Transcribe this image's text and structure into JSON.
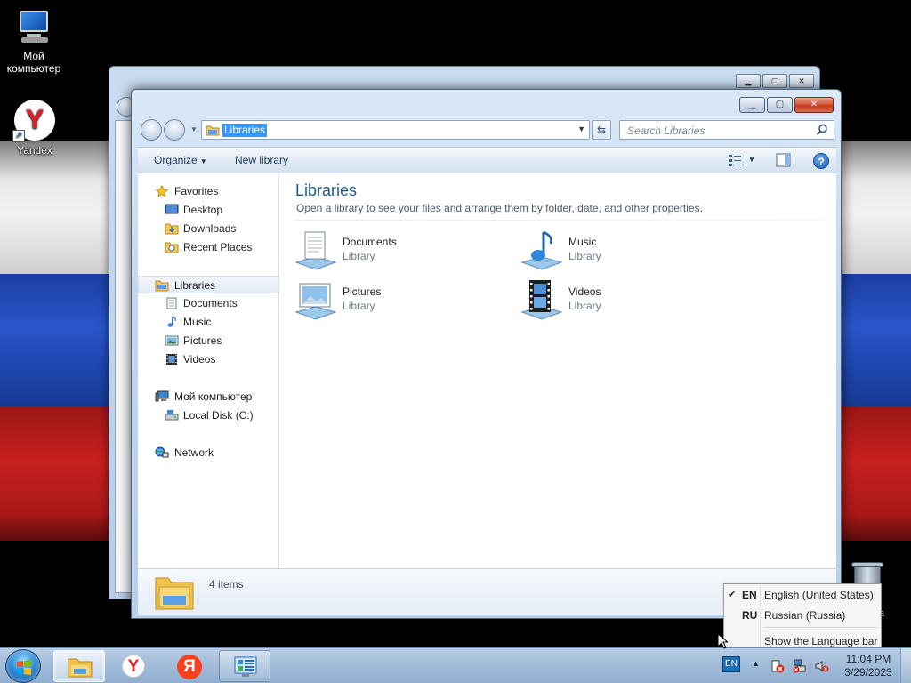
{
  "desktop": {
    "icons": [
      {
        "label": "Мой компьютер",
        "icon": "computer-icon"
      },
      {
        "label": "Yandex",
        "icon": "yandex-browser-icon"
      }
    ],
    "recycle_label": "a"
  },
  "explorer": {
    "address": "Libraries",
    "search_placeholder": "Search Libraries",
    "toolbar": {
      "organize": "Organize",
      "new_library": "New library"
    },
    "nav": {
      "favorites": "Favorites",
      "favorites_items": [
        "Desktop",
        "Downloads",
        "Recent Places"
      ],
      "libraries": "Libraries",
      "libraries_items": [
        "Documents",
        "Music",
        "Pictures",
        "Videos"
      ],
      "computer": "Мой компьютер",
      "computer_items": [
        "Local Disk (C:)"
      ],
      "network": "Network"
    },
    "main": {
      "title": "Libraries",
      "subtitle": "Open a library to see your files and arrange them by folder, date, and other properties.",
      "items": [
        {
          "name": "Documents",
          "kind": "Library",
          "icon": "documents-library-icon"
        },
        {
          "name": "Music",
          "kind": "Library",
          "icon": "music-library-icon"
        },
        {
          "name": "Pictures",
          "kind": "Library",
          "icon": "pictures-library-icon"
        },
        {
          "name": "Videos",
          "kind": "Library",
          "icon": "videos-library-icon"
        }
      ]
    },
    "details": {
      "count": "4 items"
    }
  },
  "language_menu": {
    "items": [
      {
        "code": "EN",
        "label": "English (United States)",
        "checked": true
      },
      {
        "code": "RU",
        "label": "Russian (Russia)",
        "checked": false
      }
    ],
    "show_bar": "Show the Language bar"
  },
  "taskbar": {
    "lang": "EN",
    "time": "11:04 PM",
    "date": "3/29/2023",
    "pinned": [
      "explorer-icon",
      "yandex-browser-icon",
      "yandex-icon",
      "control-panel-icon"
    ]
  },
  "colors": {
    "accent": "#3399ff",
    "title_blue": "#1e5b8c",
    "flag_white": "#f2f2f2",
    "flag_blue": "#2a56c9",
    "flag_red": "#c82020"
  }
}
